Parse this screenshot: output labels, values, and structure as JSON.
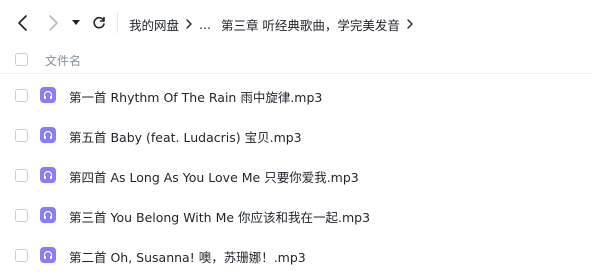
{
  "toolbar": {
    "back_icon": "chevron-left-icon",
    "forward_icon": "chevron-right-icon",
    "dropdown_icon": "caret-down-icon",
    "refresh_icon": "refresh-icon"
  },
  "breadcrumb": {
    "root": "我的网盘",
    "ellipsis": "...",
    "current": "第三章 听经典歌曲，学完美发音"
  },
  "header": {
    "column_name": "文件名"
  },
  "files": [
    {
      "name": "第一首 Rhythm Of The Rain 雨中旋律.mp3",
      "icon": "audio-file-icon"
    },
    {
      "name": "第五首 Baby (feat. Ludacris) 宝贝.mp3",
      "icon": "audio-file-icon"
    },
    {
      "name": "第四首 As Long As You Love Me 只要你爱我.mp3",
      "icon": "audio-file-icon"
    },
    {
      "name": "第三首 You Belong With Me 你应该和我在一起.mp3",
      "icon": "audio-file-icon"
    },
    {
      "name": "第二首 Oh, Susanna! 噢，苏珊娜！.mp3",
      "icon": "audio-file-icon"
    }
  ],
  "colors": {
    "audio_icon": "#8a7cf5",
    "text": "#1f2329",
    "muted": "#86909c"
  }
}
